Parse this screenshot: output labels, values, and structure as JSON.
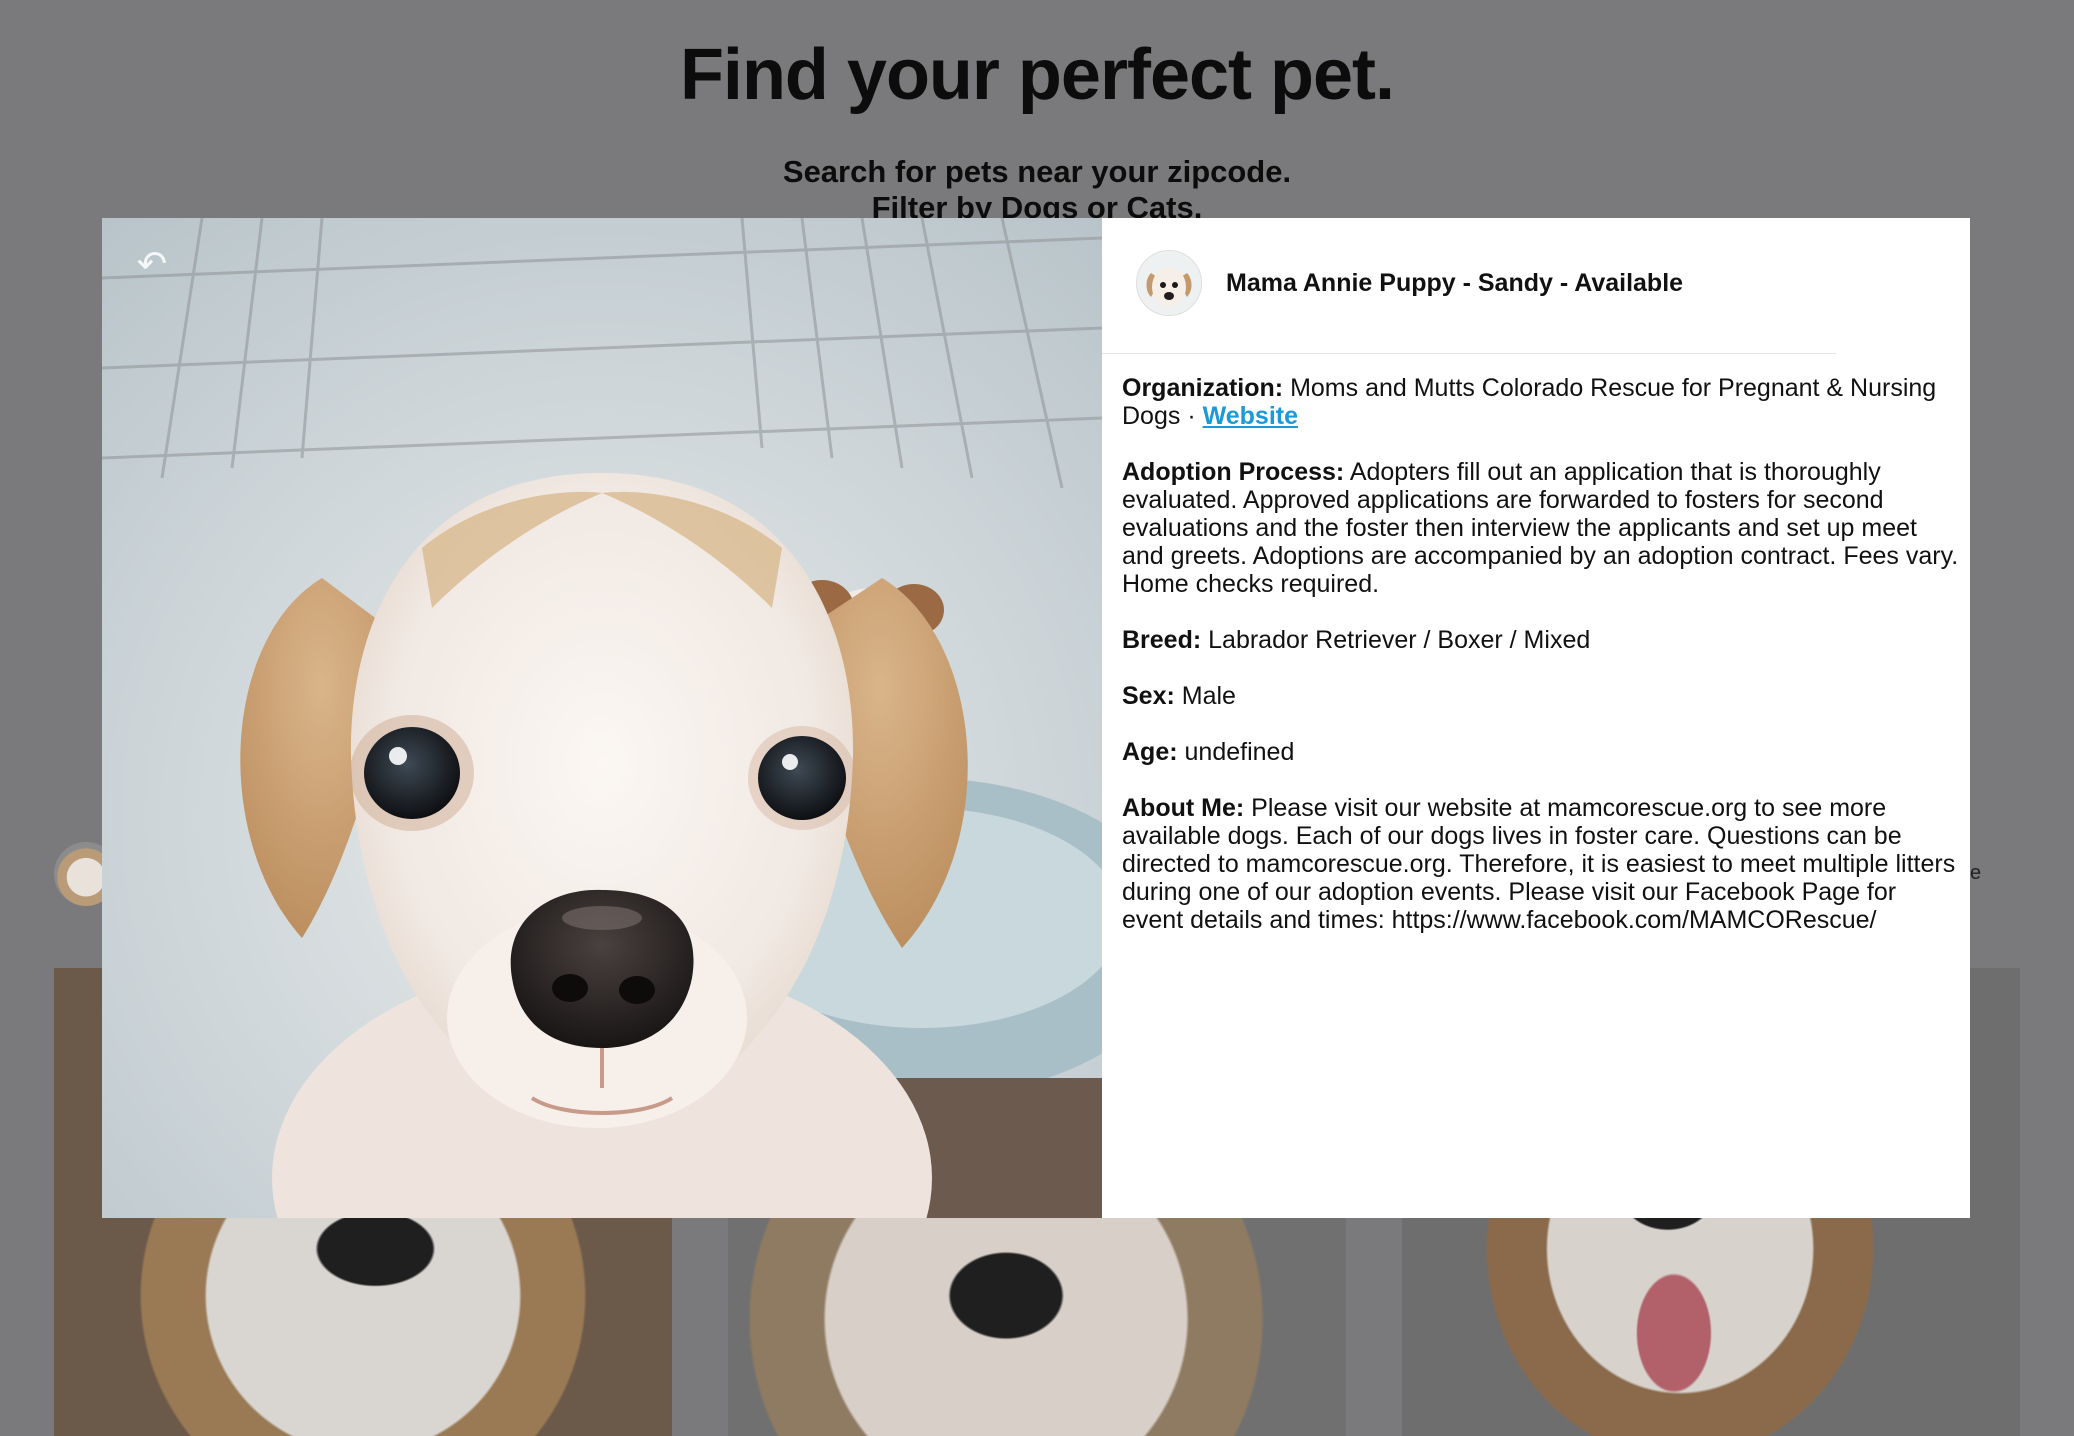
{
  "header": {
    "title": "Find your perfect pet.",
    "subtitle_line1": "Search for pets near your zipcode.",
    "subtitle_line2": "Filter by Dogs or Cats."
  },
  "modal": {
    "pet_name": "Mama Annie Puppy - Sandy - Available",
    "close_icon": "close-icon",
    "organization_label": "Organization:",
    "organization_value": "Moms and Mutts Colorado Rescue for Pregnant & Nursing Dogs",
    "separator": " · ",
    "website_link": "Website",
    "adoption_label": "Adoption Process:",
    "adoption_value": "Adopters fill out an application that is thoroughly evaluated. Approved applications are forwarded to fosters for second evaluations and the foster then interview the applicants and set up meet and greets. Adoptions are accompanied by an adoption contract. Fees vary. Home checks required.",
    "breed_label": "Breed:",
    "breed_value": "Labrador Retriever / Boxer / Mixed",
    "sex_label": "Sex:",
    "sex_value": "Male",
    "age_label": "Age:",
    "age_value": "undefined",
    "about_label": "About Me:",
    "about_value": "Please visit our website at mamcorescue.org to see more available dogs. Each of our dogs lives in foster care. Questions can be directed to mamcorescue.org. Therefore, it is easiest to meet multiple litters during one of our adoption events. Please visit our Facebook Page for event details and times: https://www.facebook.com/MAMCORescue/"
  },
  "colors": {
    "overlay": "#7a7a7c",
    "link": "#1a9ad6",
    "modal_bg": "#ffffff"
  }
}
